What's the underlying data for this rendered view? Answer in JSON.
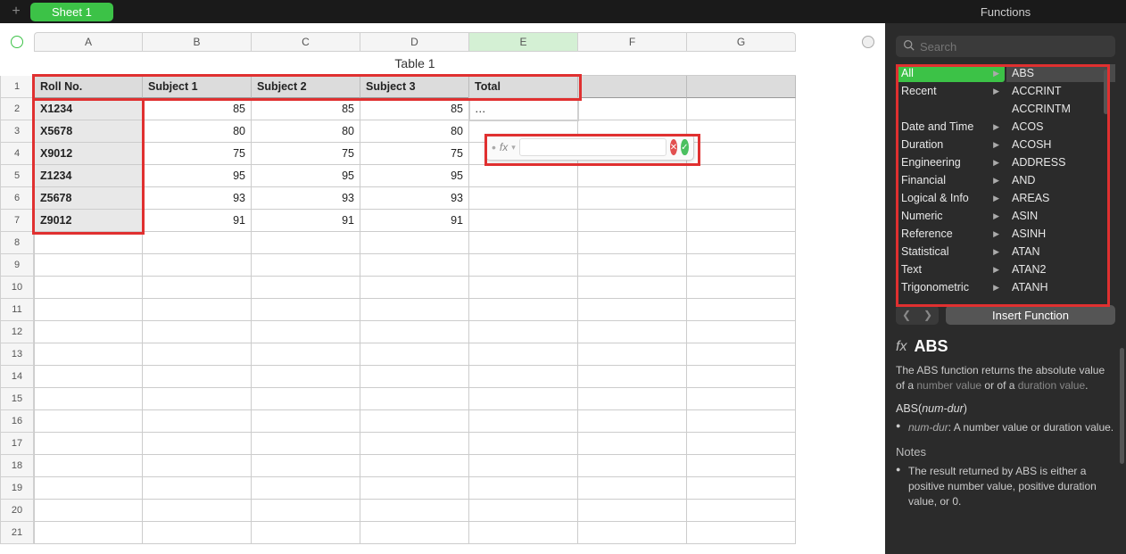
{
  "tabs": {
    "sheet1": "Sheet 1"
  },
  "columns": [
    "A",
    "B",
    "C",
    "D",
    "E",
    "F",
    "G"
  ],
  "table_title": "Table 1",
  "headers": {
    "a": "Roll No.",
    "b": "Subject 1",
    "c": "Subject 2",
    "d": "Subject 3",
    "e": "Total"
  },
  "rows": [
    {
      "roll": "X1234",
      "s1": "85",
      "s2": "85",
      "s3": "85",
      "total": "…"
    },
    {
      "roll": "X5678",
      "s1": "80",
      "s2": "80",
      "s3": "80",
      "total": ""
    },
    {
      "roll": "X9012",
      "s1": "75",
      "s2": "75",
      "s3": "75",
      "total": ""
    },
    {
      "roll": "Z1234",
      "s1": "95",
      "s2": "95",
      "s3": "95",
      "total": ""
    },
    {
      "roll": "Z5678",
      "s1": "93",
      "s2": "93",
      "s3": "93",
      "total": ""
    },
    {
      "roll": "Z9012",
      "s1": "91",
      "s2": "91",
      "s3": "91",
      "total": ""
    }
  ],
  "row_numbers": [
    "1",
    "2",
    "3",
    "4",
    "5",
    "6",
    "7",
    "8",
    "9",
    "10",
    "11",
    "12",
    "13",
    "14",
    "15",
    "16",
    "17",
    "18",
    "19",
    "20",
    "21"
  ],
  "formula_popup": {
    "fx": "fx",
    "value": ""
  },
  "functions_panel": {
    "title": "Functions",
    "search_placeholder": "Search",
    "categories": [
      "All",
      "Recent",
      "",
      "Date and Time",
      "Duration",
      "Engineering",
      "Financial",
      "Logical & Info",
      "Numeric",
      "Reference",
      "Statistical",
      "Text",
      "Trigonometric"
    ],
    "functions": [
      "ABS",
      "ACCRINT",
      "ACCRINTM",
      "ACOS",
      "ACOSH",
      "ADDRESS",
      "AND",
      "AREAS",
      "ASIN",
      "ASINH",
      "ATAN",
      "ATAN2",
      "ATANH"
    ],
    "insert_label": "Insert Function",
    "detail": {
      "fx": "fx",
      "name": "ABS",
      "desc_pre": "The ABS function returns the absolute value of a ",
      "desc_link1": "number value",
      "desc_mid": " or of a ",
      "desc_link2": "duration value",
      "desc_post": ".",
      "syntax_pre": "ABS(",
      "syntax_param": "num-dur",
      "syntax_post": ")",
      "param_name": "num-dur",
      "param_desc": ": A number value or duration value.",
      "notes_header": "Notes",
      "note1": "The result returned by ABS is either a positive number value, positive duration value, or 0."
    }
  }
}
